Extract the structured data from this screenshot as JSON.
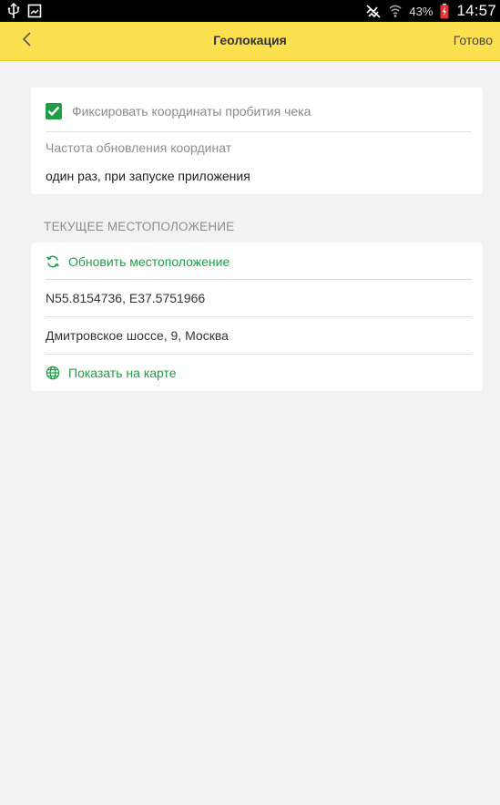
{
  "status_bar": {
    "usb_icon": "usb-icon",
    "screenshot_icon": "screenshot-icon",
    "mute_icon": "vibrate-mute-icon",
    "wifi_icon": "wifi-icon",
    "battery_percent": "43%",
    "battery_icon": "battery-charging-icon",
    "time": "14:57"
  },
  "header": {
    "back_icon": "chevron-left-icon",
    "title": "Геолокация",
    "done_label": "Готово",
    "background": "#fbe14f"
  },
  "settings_card": {
    "fix_coordinates": {
      "checked": true,
      "label": "Фиксировать координаты пробития чека"
    },
    "update_frequency_label": "Частота обновления координат",
    "update_frequency_value": "один раз, при запуске приложения"
  },
  "current_location": {
    "section_title": "ТЕКУЩЕЕ МЕСТОПОЛОЖЕНИЕ",
    "refresh_icon": "refresh-icon",
    "refresh_label": "Обновить местоположение",
    "coordinates": "N55.8154736, E37.5751966",
    "address": "Дмитровское шоссе, 9, Москва",
    "map_icon": "globe-icon",
    "show_on_map_label": "Показать на карте"
  },
  "colors": {
    "accent_green": "#1f9e46",
    "header_yellow": "#fbe14f",
    "page_background": "#f2f2f2"
  }
}
